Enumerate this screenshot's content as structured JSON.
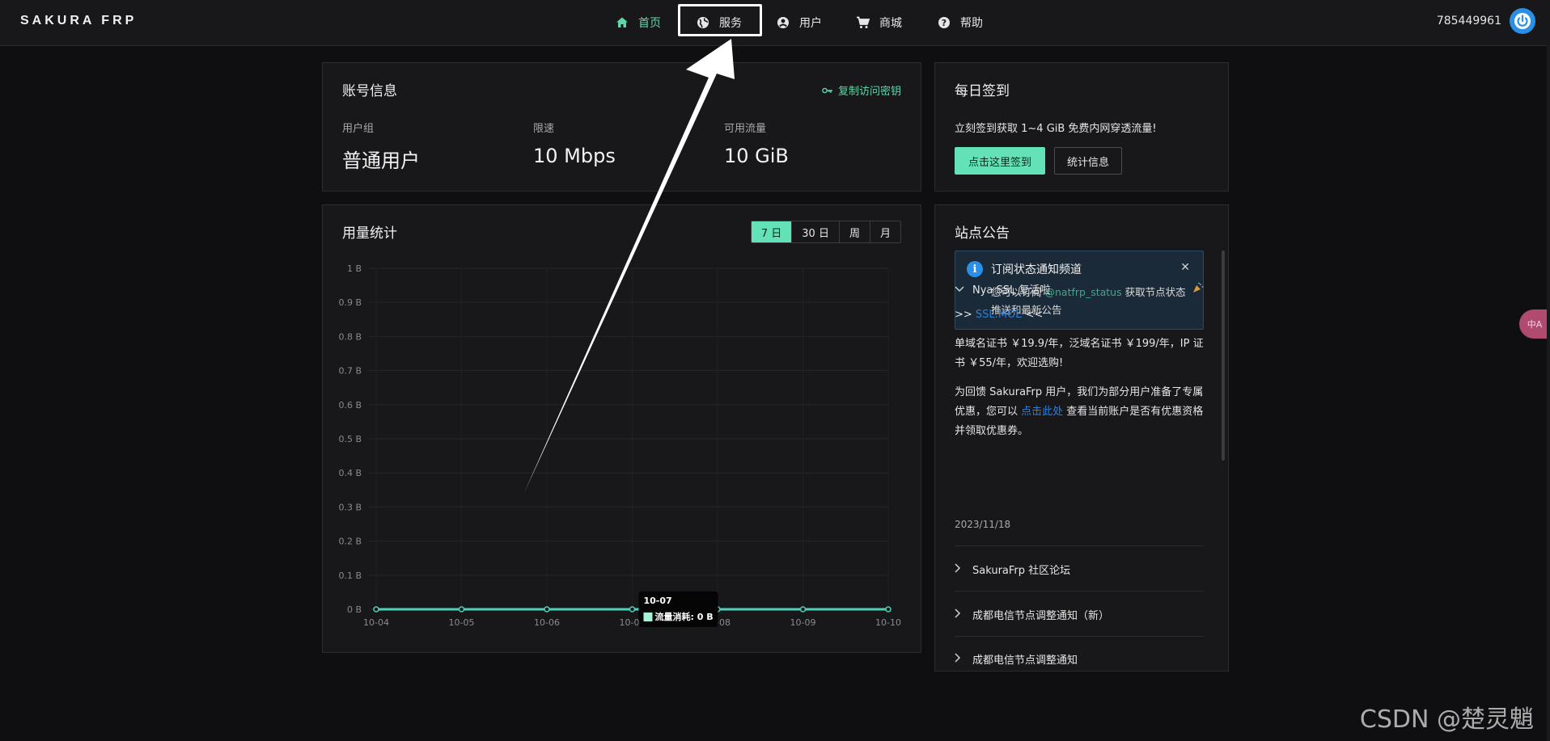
{
  "header": {
    "logo": "SAKURA FRP",
    "nav": [
      {
        "label": "首页",
        "icon": "home-icon",
        "active": true
      },
      {
        "label": "服务",
        "icon": "globe-icon",
        "active": false
      },
      {
        "label": "用户",
        "icon": "user-icon",
        "active": false
      },
      {
        "label": "商城",
        "icon": "cart-icon",
        "active": false
      },
      {
        "label": "帮助",
        "icon": "help-icon",
        "active": false
      }
    ],
    "user_id": "785449961",
    "avatar_icon": "power-icon"
  },
  "account": {
    "title": "账号信息",
    "copy_key": "复制访问密钥",
    "stats": [
      {
        "label": "用户组",
        "value": "普通用户"
      },
      {
        "label": "限速",
        "value": "10 Mbps"
      },
      {
        "label": "可用流量",
        "value": "10 GiB"
      }
    ]
  },
  "checkin": {
    "title": "每日签到",
    "text": "立刻签到获取 1~4 GiB 免费内网穿透流量!",
    "primary_button": "点击这里签到",
    "secondary_button": "统计信息"
  },
  "usage": {
    "title": "用量统计",
    "ranges": [
      "7 日",
      "30 日",
      "周",
      "月"
    ],
    "active_range": "7 日",
    "tooltip": {
      "date": "10-07",
      "label": "流量消耗: 0 B"
    }
  },
  "chart_data": {
    "type": "line",
    "categories": [
      "10-04",
      "10-05",
      "10-06",
      "10-07",
      "10-08",
      "10-09",
      "10-10"
    ],
    "series": [
      {
        "name": "流量消耗",
        "values": [
          0,
          0,
          0,
          0,
          0,
          0,
          0
        ]
      }
    ],
    "yticks": [
      "0 B",
      "0.1 B",
      "0.2 B",
      "0.3 B",
      "0.4 B",
      "0.5 B",
      "0.6 B",
      "0.7 B",
      "0.8 B",
      "0.9 B",
      "1 B"
    ],
    "ylim": [
      0,
      1
    ],
    "grid": true,
    "colors": {
      "line": "#4fd1b8"
    }
  },
  "notices": {
    "title": "站点公告",
    "alert": {
      "title": "订阅状态通知频道",
      "body_before": "您可以订阅 ",
      "link": "@natfrp_status",
      "body_after": " 获取节点状态推送和最新公告"
    },
    "expanded": {
      "title": "Nya SSL 复活啦",
      "line1_prefix": ">> ",
      "line1_link": "SSL.MOE",
      "line1_suffix": " <<",
      "para1": "单域名证书 ￥19.9/年，泛域名证书 ￥199/年，IP 证书 ￥55/年，欢迎选购!",
      "para2_before": "为回馈 SakuraFrp 用户，我们为部分用户准备了专属优惠，您可以 ",
      "para2_link": "点击此处",
      "para2_after": " 查看当前账户是否有优惠资格并领取优惠券。",
      "date": "2023/11/18"
    },
    "items": [
      "SakuraFrp 社区论坛",
      "成都电信节点调整通知（新）",
      "成都电信节点调整通知"
    ]
  },
  "side_widget": "中A",
  "watermark": "CSDN @楚灵魈"
}
